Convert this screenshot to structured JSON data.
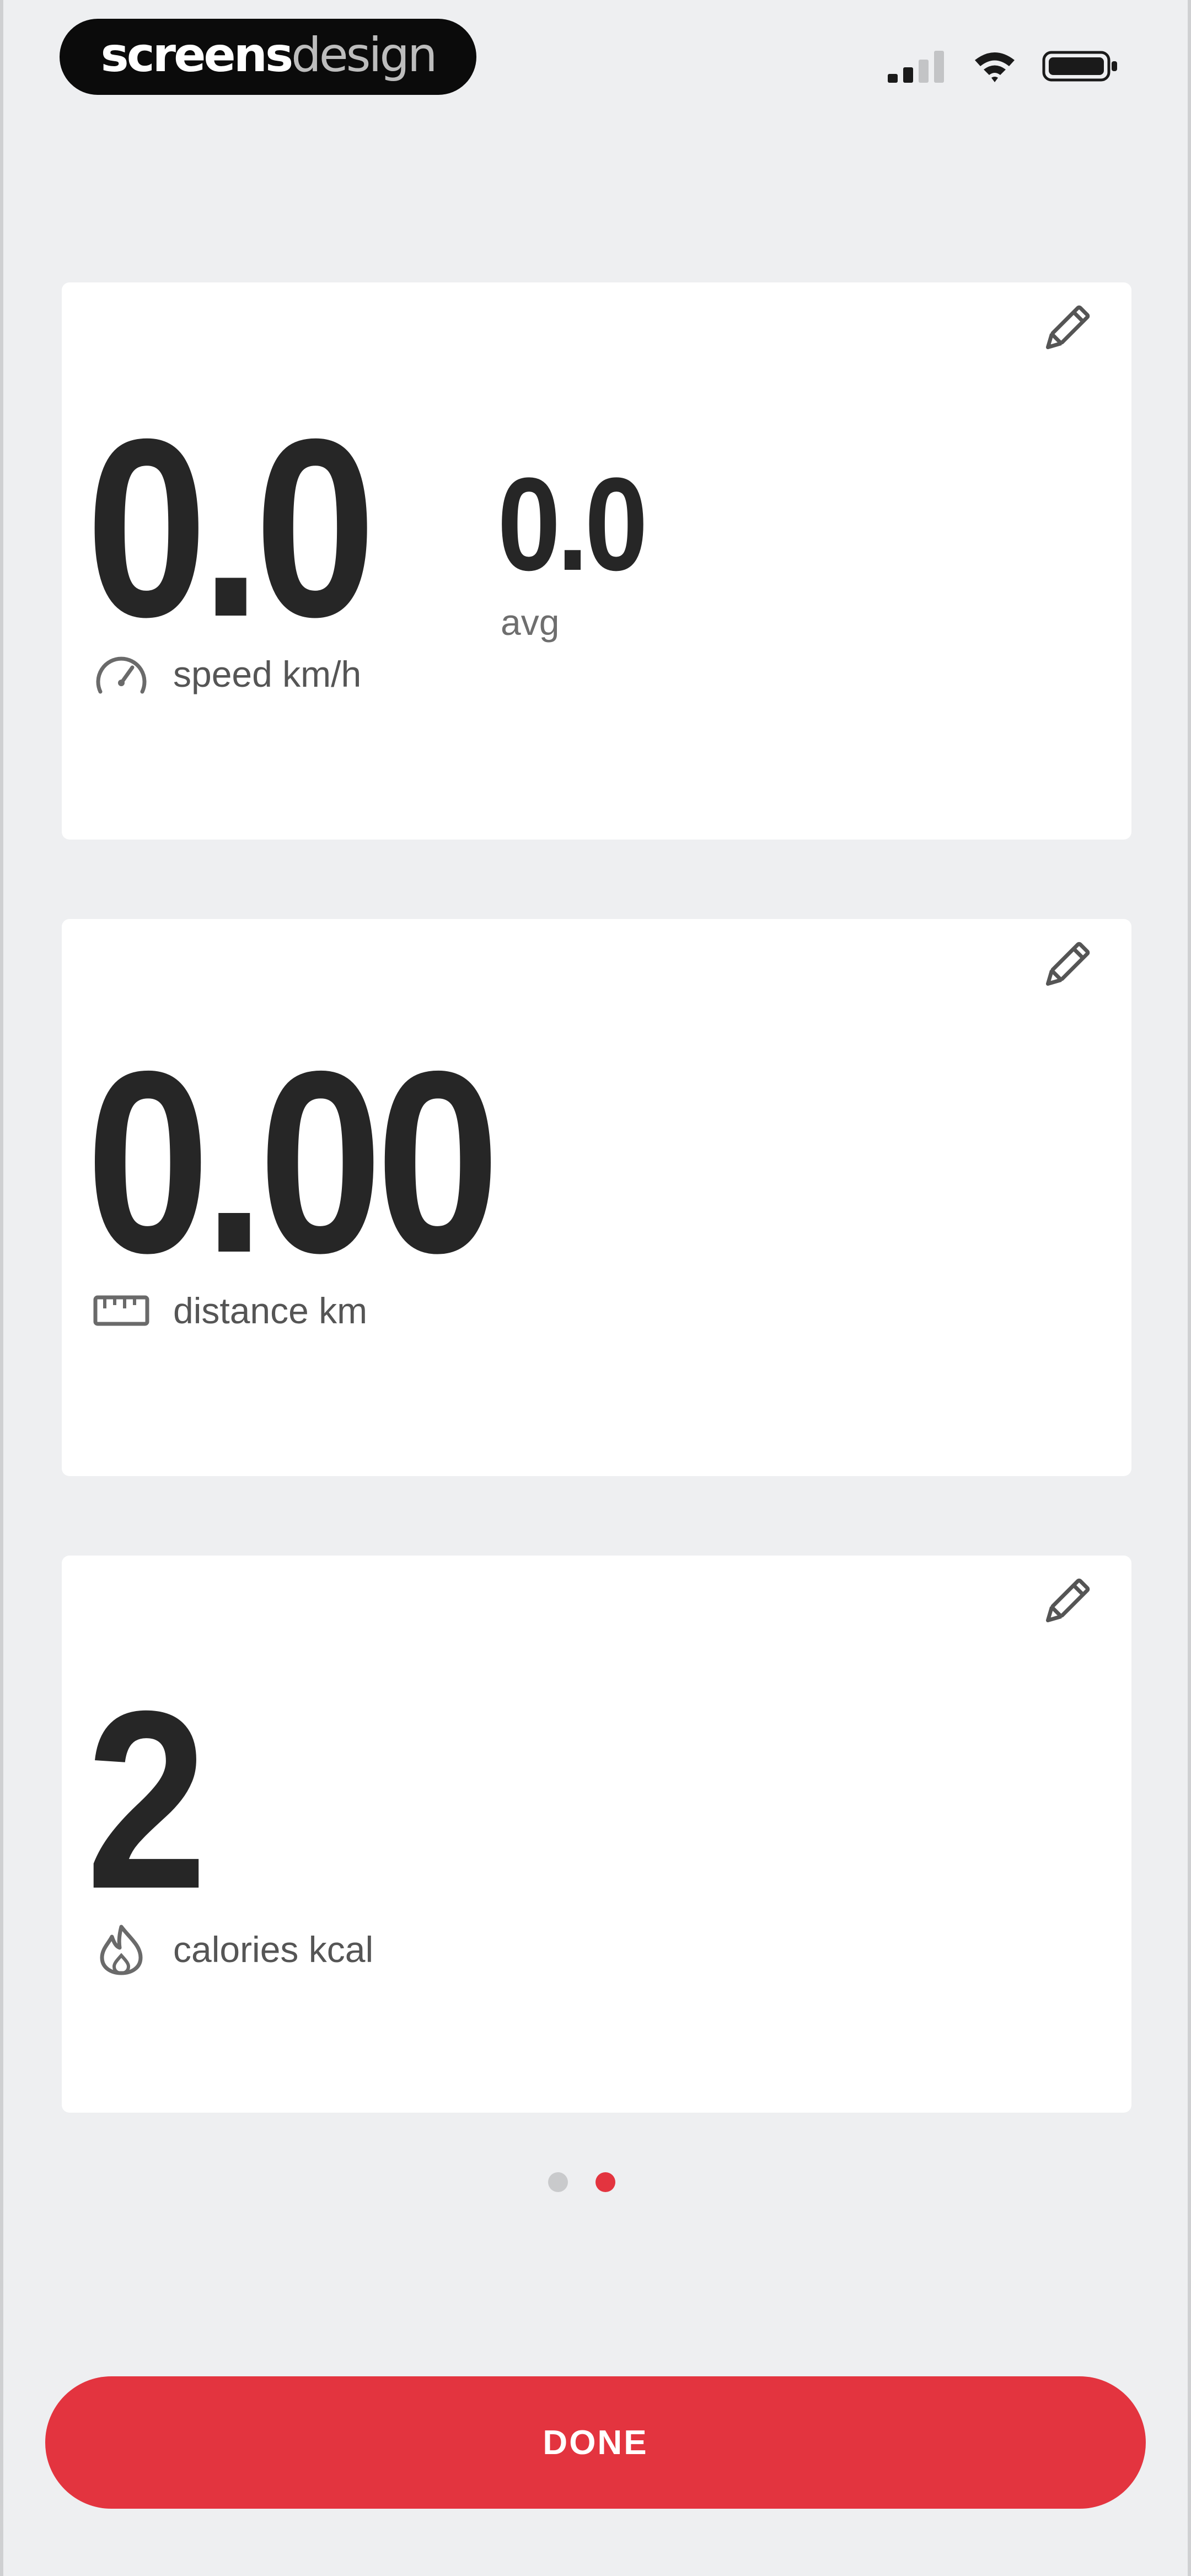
{
  "status_bar": {
    "brand_bold": "screens",
    "brand_light": "design",
    "icons": [
      "cellular-signal-icon",
      "wifi-icon",
      "battery-icon"
    ]
  },
  "cards": {
    "speed": {
      "value": "0.0",
      "label": "speed km/h",
      "avg_value": "0.0",
      "avg_label": "avg",
      "icon": "speedometer-icon",
      "edit_icon": "pencil-icon"
    },
    "distance": {
      "value": "0.00",
      "label": "distance km",
      "icon": "ruler-icon",
      "edit_icon": "pencil-icon"
    },
    "calories": {
      "value": "2",
      "label": "calories kcal",
      "icon": "flame-icon",
      "edit_icon": "pencil-icon"
    }
  },
  "pagination": {
    "pages": 2,
    "current": 2
  },
  "done_button": {
    "label": "DONE"
  },
  "colors": {
    "accent": "#e3343f",
    "background": "#eeeff1",
    "card": "#ffffff",
    "text": "#262626"
  }
}
